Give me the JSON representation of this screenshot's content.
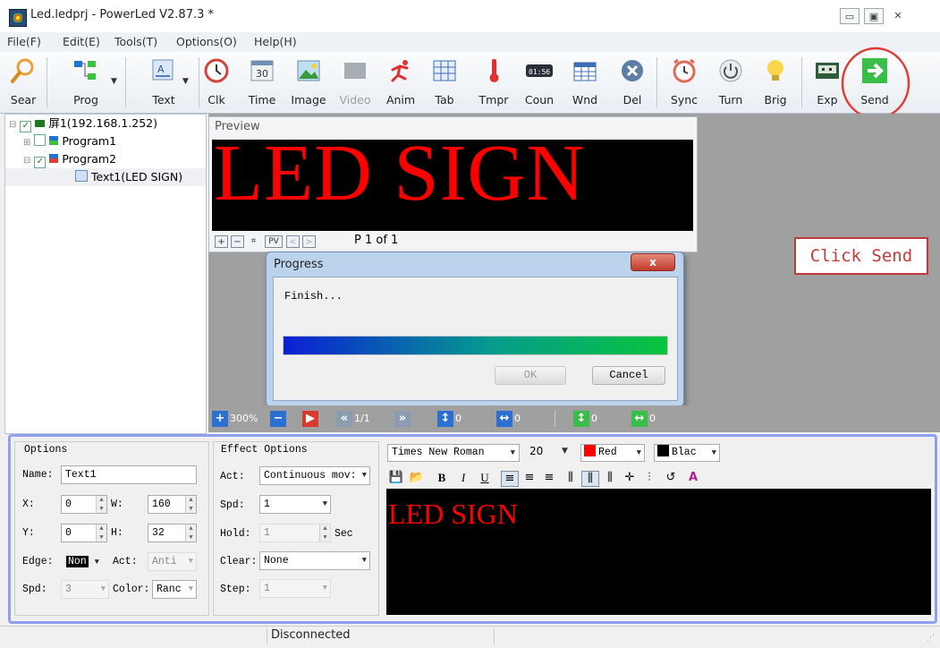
{
  "window": {
    "title": "Led.ledprj - PowerLed V2.87.3 *",
    "buttons": {
      "minimize": "▭",
      "maximize": "▣",
      "close": "✕"
    }
  },
  "menu": [
    "File(F)",
    "Edit(E)",
    "Tools(T)",
    "Options(O)",
    "Help(H)"
  ],
  "toolbar": {
    "items": [
      {
        "label": "Sear",
        "icon": "search-icon"
      },
      {
        "label": "Prog",
        "icon": "program-icon"
      },
      {
        "label": "Text",
        "icon": "text-icon"
      },
      {
        "label": "Clk",
        "icon": "clock-icon"
      },
      {
        "label": "Time",
        "icon": "calendar-icon"
      },
      {
        "label": "Image",
        "icon": "image-icon"
      },
      {
        "label": "Video",
        "icon": "video-icon"
      },
      {
        "label": "Anim",
        "icon": "animation-icon"
      },
      {
        "label": "Tab",
        "icon": "table-icon"
      },
      {
        "label": "Tmpr",
        "icon": "thermometer-icon"
      },
      {
        "label": "Coun",
        "icon": "counter-icon"
      },
      {
        "label": "Wnd",
        "icon": "window-icon"
      },
      {
        "label": "Del",
        "icon": "delete-icon"
      },
      {
        "label": "Sync",
        "icon": "alarm-icon"
      },
      {
        "label": "Turn",
        "icon": "power-icon"
      },
      {
        "label": "Brig",
        "icon": "bulb-icon"
      },
      {
        "label": "Exp",
        "icon": "export-icon"
      },
      {
        "label": "Send",
        "icon": "send-arrow-icon"
      }
    ],
    "counter_icon_text": "01:56",
    "calendar_icon_text": "30"
  },
  "tree": {
    "screen": "屏1(192.168.1.252)",
    "program1": "Program1",
    "program2": "Program2",
    "text1": "Text1(LED SIGN)"
  },
  "preview": {
    "title": "Preview",
    "led_text": "LED SIGN",
    "page": "P 1 of 1",
    "controls": [
      "+",
      "−",
      "⌗",
      "PV",
      "<",
      ">"
    ]
  },
  "annotation": {
    "callout": "Click Send",
    "accent": "#e03b35"
  },
  "progress_dialog": {
    "title": "Progress",
    "close": "x",
    "status": "Finish...",
    "progress": 1.0,
    "ok": "OK",
    "cancel": "Cancel"
  },
  "strip": {
    "zoom": "300%",
    "page": "1/1",
    "v1": "0",
    "v2": "0",
    "v3": "0",
    "v4": "0"
  },
  "options": {
    "title": "Options",
    "name_label": "Name:",
    "name": "Text1",
    "x_label": "X:",
    "x": "0",
    "w_label": "W:",
    "w": "160",
    "y_label": "Y:",
    "y": "0",
    "h_label": "H:",
    "h": "32",
    "edge_label": "Edge:",
    "edge": "Non",
    "act_label": "Act:",
    "act": "Anti",
    "spd_label": "Spd:",
    "spd": "3",
    "color_label": "Color:",
    "color": "Ranc"
  },
  "effect": {
    "title": "Effect Options",
    "act_label": "Act:",
    "act": "Continuous mov:",
    "spd_label": "Spd:",
    "spd": "1",
    "hold_label": "Hold:",
    "hold": "1",
    "hold_unit": "Sec",
    "clear_label": "Clear:",
    "clear": "None",
    "step_label": "Step:",
    "step": "1"
  },
  "format": {
    "font": "Times New Roman",
    "size": "20",
    "fg": "Red",
    "fg_color": "#ff0000",
    "bg": "Blac",
    "bg_color": "#000000",
    "buttons": [
      "💾",
      "📂",
      "B",
      "I",
      "U",
      "≡",
      "≡",
      "≡",
      "⫼",
      "⫼",
      "⫼",
      "✛",
      "⫶",
      "↺",
      "A"
    ]
  },
  "editor": {
    "text": "LED SIGN"
  },
  "status": {
    "connection": "Disconnected"
  }
}
